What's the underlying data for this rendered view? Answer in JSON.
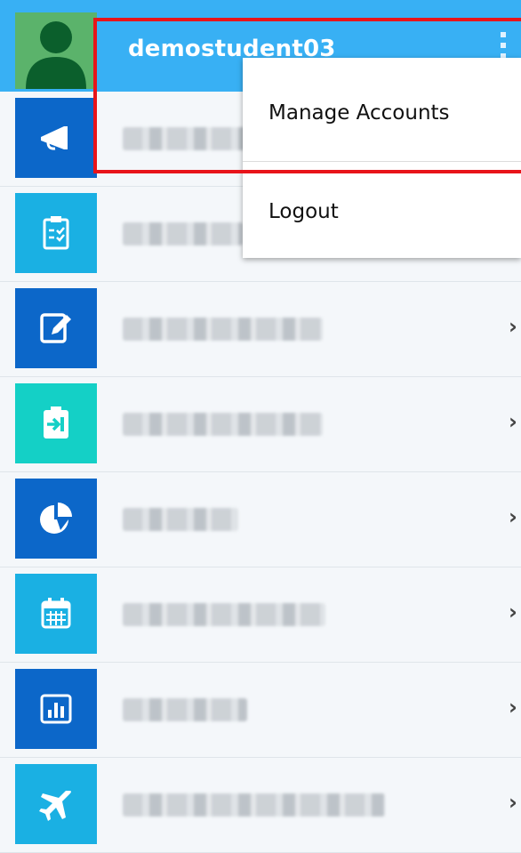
{
  "header": {
    "username": "demostudent03",
    "avatar_icon": "person-icon",
    "menu_icon": "kebab-menu-icon",
    "background": "#38b0f4"
  },
  "menu": {
    "items": [
      {
        "label": "Manage Accounts"
      },
      {
        "label": "Logout"
      }
    ]
  },
  "list": {
    "items": [
      {
        "icon": "megaphone-icon",
        "color": "#0c67c9",
        "has_chevron": false
      },
      {
        "icon": "clipboard-checklist-icon",
        "color": "#1ab0e3",
        "has_chevron": false
      },
      {
        "icon": "edit-document-icon",
        "color": "#0c67c9",
        "has_chevron": true
      },
      {
        "icon": "clipboard-login-icon",
        "color": "#14d0c6",
        "has_chevron": true
      },
      {
        "icon": "pie-chart-icon",
        "color": "#0c67c9",
        "has_chevron": true
      },
      {
        "icon": "calendar-icon",
        "color": "#1ab0e3",
        "has_chevron": true
      },
      {
        "icon": "bar-chart-icon",
        "color": "#0c67c9",
        "has_chevron": true
      },
      {
        "icon": "airplane-icon",
        "color": "#1ab0e3",
        "has_chevron": true
      }
    ],
    "chevron": "›"
  }
}
